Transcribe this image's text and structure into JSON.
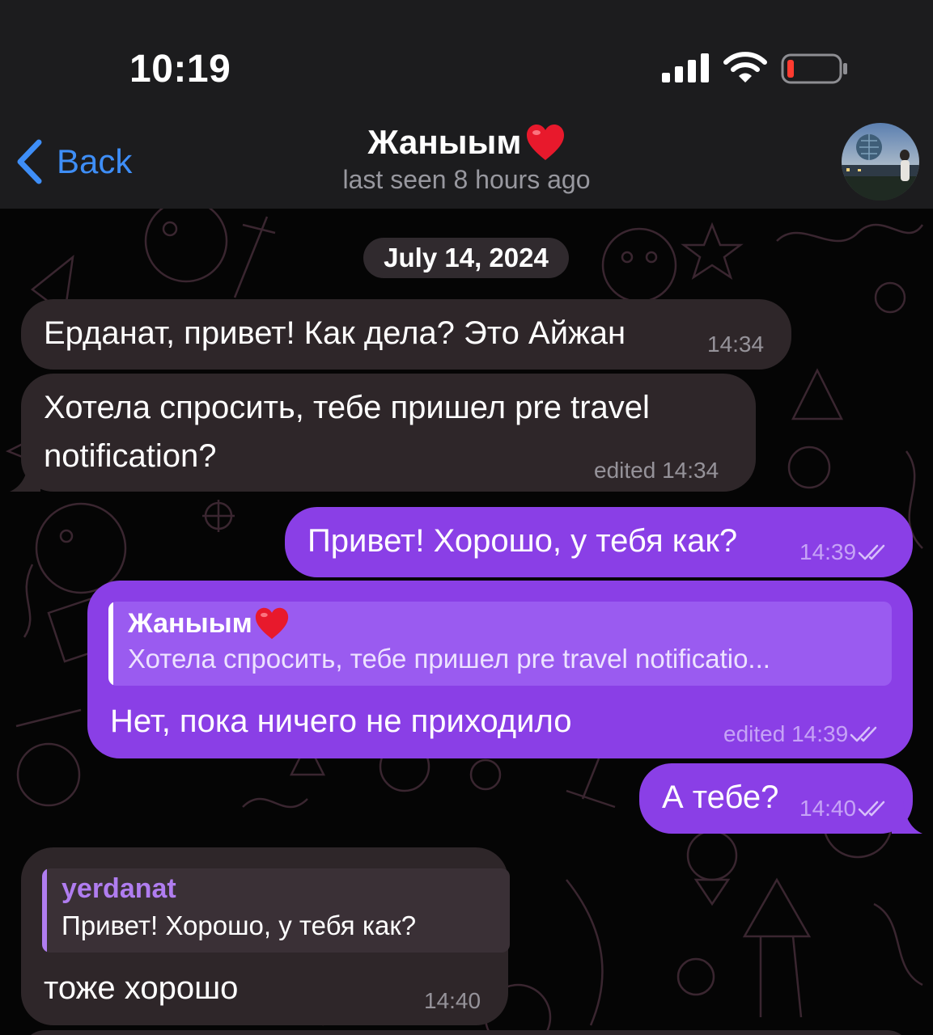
{
  "status_bar": {
    "time": "10:19"
  },
  "header": {
    "back_label": "Back",
    "title": "Жаныым",
    "subtitle": "last seen 8 hours ago"
  },
  "date_separator": "July 14, 2024",
  "messages": [
    {
      "direction": "incoming",
      "text": "Ерданат, привет! Как дела? Это Айжан",
      "time": "14:34"
    },
    {
      "direction": "incoming",
      "text_line1": "Хотела спросить, тебе пришел pre travel",
      "text_line2": "notification?",
      "time": "edited 14:34"
    },
    {
      "direction": "outgoing",
      "text": "Привет! Хорошо, у тебя как?",
      "time": "14:39",
      "read": true
    },
    {
      "direction": "outgoing",
      "reply_name": "Жаныым",
      "reply_text": "Хотела спросить, тебе пришел pre travel notificatio...",
      "text": "Нет, пока ничего не приходило",
      "time": "edited 14:39",
      "read": true
    },
    {
      "direction": "outgoing",
      "text": "А тебе?",
      "time": "14:40",
      "read": true
    },
    {
      "direction": "incoming",
      "reply_name": "yerdanat",
      "reply_text": "Привет! Хорошо, у тебя как?",
      "text": "тоже хорошо",
      "time": "14:40"
    }
  ],
  "colors": {
    "accent": "#3e8ef7",
    "incoming_bubble": "#2e2629",
    "outgoing_bubble": "#8a3fe6",
    "reply_name_incoming": "#b07df0",
    "battery_low": "#ff3b30"
  },
  "icons": [
    "signal-icon",
    "wifi-icon",
    "battery-icon",
    "back-chevron-icon",
    "heart-emoji-icon",
    "double-check-icon"
  ]
}
